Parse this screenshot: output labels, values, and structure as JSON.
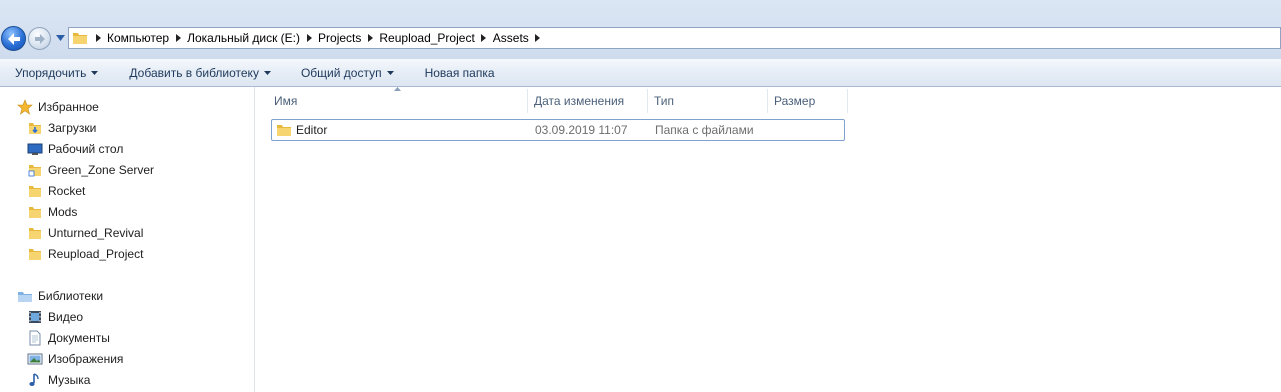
{
  "address_bar": {
    "crumbs": [
      "Компьютер",
      "Локальный диск (E:)",
      "Projects",
      "Reupload_Project",
      "Assets"
    ]
  },
  "toolbar": {
    "organize_label": "Упорядочить",
    "add_to_library_label": "Добавить в библиотеку",
    "share_label": "Общий доступ",
    "new_folder_label": "Новая папка"
  },
  "nav": {
    "favorites_label": "Избранное",
    "favorites": [
      "Загрузки",
      "Рабочий стол",
      "Green_Zone Server",
      "Rocket",
      "Mods",
      "Unturned_Revival",
      "Reupload_Project"
    ],
    "libraries_label": "Библиотеки",
    "libraries": [
      "Видео",
      "Документы",
      "Изображения",
      "Музыка"
    ]
  },
  "columns": {
    "name": "Имя",
    "date": "Дата изменения",
    "type": "Тип",
    "size": "Размер"
  },
  "files": [
    {
      "name": "Editor",
      "date": "03.09.2019 11:07",
      "type": "Папка с файлами",
      "size": ""
    }
  ],
  "colors": {
    "accent": "#2a6fd6",
    "selection_border": "#7da2ce",
    "folder": "#f2c94c"
  }
}
